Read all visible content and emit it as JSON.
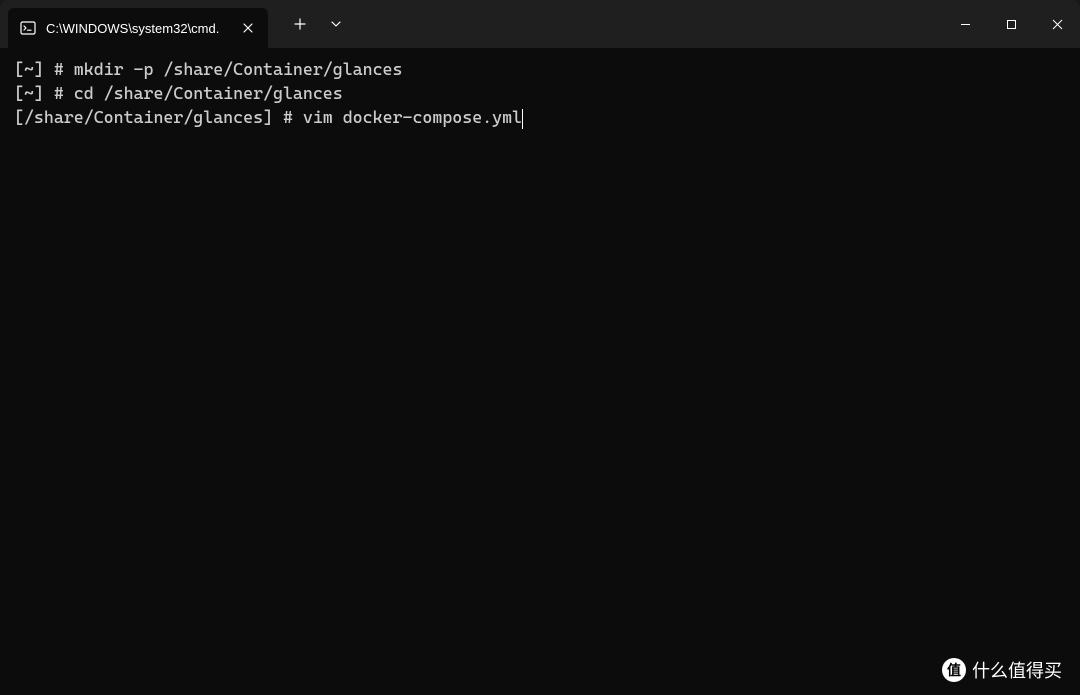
{
  "tab": {
    "title": "C:\\WINDOWS\\system32\\cmd."
  },
  "terminal": {
    "lines": [
      {
        "prompt": "[~] # ",
        "cmd": "mkdir -p /share/Container/glances"
      },
      {
        "prompt": "[~] # ",
        "cmd": "cd /share/Container/glances"
      },
      {
        "prompt": "[/share/Container/glances] # ",
        "cmd": "vim docker-compose.yml"
      }
    ]
  },
  "watermark": {
    "badge": "值",
    "text": "什么值得买"
  }
}
